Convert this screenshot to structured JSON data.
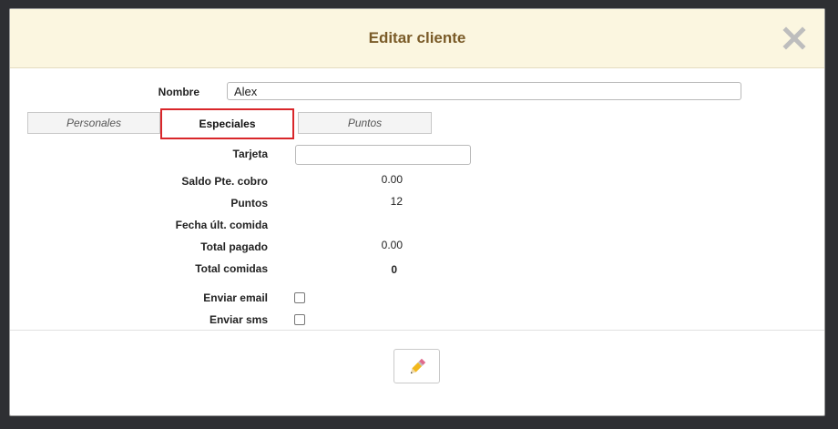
{
  "modal": {
    "title": "Editar cliente",
    "close_icon": "close-icon"
  },
  "form": {
    "nombre_label": "Nombre",
    "nombre_value": "Alex",
    "tabs": [
      {
        "label": "Personales",
        "active": false
      },
      {
        "label": "Especiales",
        "active": true
      },
      {
        "label": "Puntos",
        "active": false
      }
    ],
    "tarjeta_label": "Tarjeta",
    "tarjeta_value": "",
    "rows": [
      {
        "label": "Saldo Pte. cobro",
        "value": "0.00"
      },
      {
        "label": "Puntos",
        "value": "12"
      },
      {
        "label": "Fecha últ. comida",
        "value": ""
      },
      {
        "label": "Total pagado",
        "value": "0.00"
      },
      {
        "label": "Total comidas",
        "value": "0"
      }
    ],
    "enviar_email_label": "Enviar email",
    "enviar_email_checked": false,
    "enviar_sms_label": "Enviar sms",
    "enviar_sms_checked": false
  },
  "footer": {
    "edit_icon": "pencil-icon"
  },
  "colors": {
    "header_bg": "#fbf6e0",
    "title": "#7a5b28",
    "active_tab_border": "#d9262a"
  }
}
